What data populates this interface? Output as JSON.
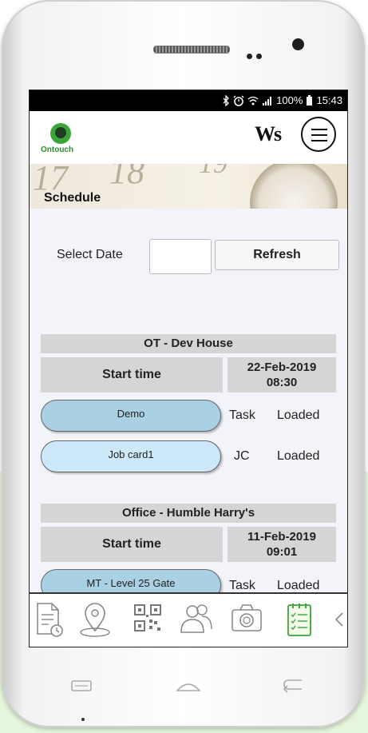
{
  "status_bar": {
    "battery": "100%",
    "time": "15:43"
  },
  "app": {
    "logo_text": "Ontouch",
    "brand_mark": "Ws"
  },
  "banner": {
    "title": "Schedule",
    "numbers": [
      "17",
      "18",
      "19"
    ]
  },
  "filter": {
    "date_label": "Select Date",
    "date_value": "",
    "refresh_label": "Refresh"
  },
  "groups": [
    {
      "location": "OT - Dev House",
      "start_label": "Start time",
      "start_date": "22-Feb-2019",
      "start_time": "08:30",
      "items": [
        {
          "name": "Demo",
          "type": "Task",
          "status": "Loaded"
        },
        {
          "name": "Job card1",
          "type": "JC",
          "status": "Loaded"
        }
      ]
    },
    {
      "location": "Office - Humble Harry's",
      "start_label": "Start time",
      "start_date": "11-Feb-2019",
      "start_time": "09:01",
      "items": [
        {
          "name": "MT - Level 25 Gate",
          "type": "Task",
          "status": "Loaded"
        }
      ]
    }
  ],
  "tabs": [
    "report-icon",
    "location-pin-icon",
    "qr-code-icon",
    "contacts-icon",
    "camera-icon",
    "schedule-checklist-icon"
  ],
  "colors": {
    "accent_green": "#3aa53a",
    "pill_blue": "#a9d0e3",
    "pill_light": "#cde8f9",
    "header_gray": "#d5d5d5"
  }
}
